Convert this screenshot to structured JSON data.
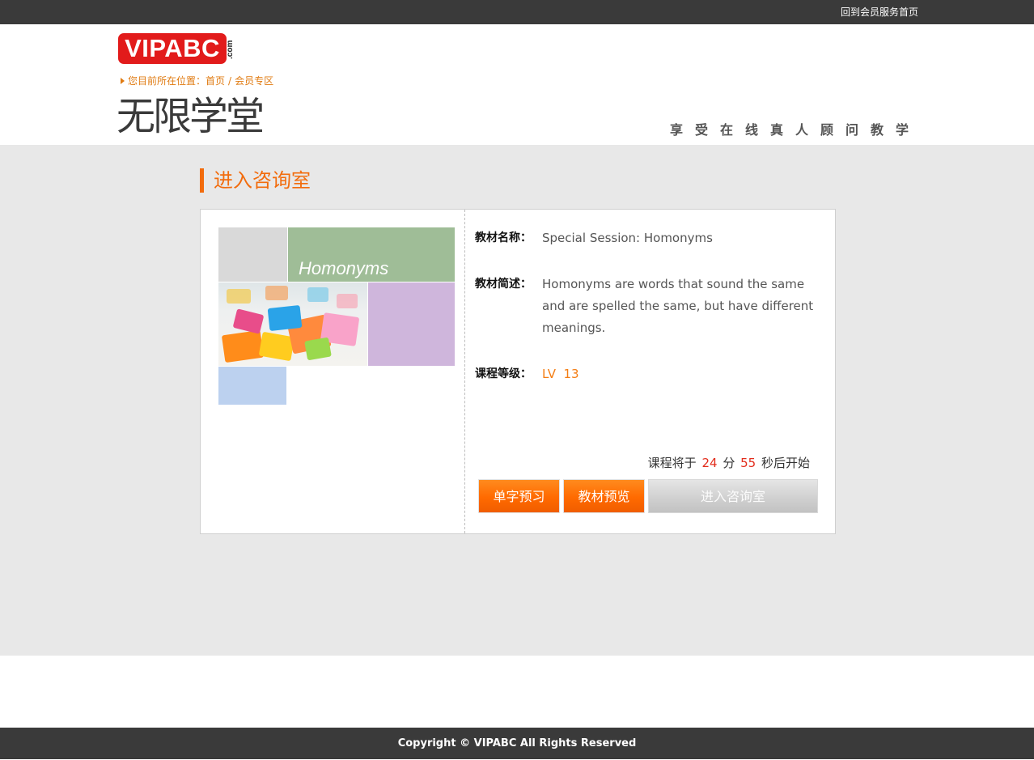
{
  "topbar": {
    "link": "回到会员服务首页"
  },
  "header": {
    "logo_text": "VIPABC",
    "logo_suffix": ".com",
    "breadcrumb_prefix": "您目前所在位置：",
    "breadcrumb": [
      "首页",
      "会员专区"
    ],
    "breadcrumb_sep": "/",
    "page_title": "无限学堂",
    "slogan": "享受在线真人顾问教学"
  },
  "section": {
    "title": "进入咨询室"
  },
  "material": {
    "thumbnail_title": "Homonyms",
    "name_label": "教材名称：",
    "name": "Special Session: Homonyms",
    "desc_label": "教材简述：",
    "desc": "Homonyms are words that sound the same and are spelled the same, but have different meanings.",
    "level_label": "课程等级：",
    "level": "LV  13"
  },
  "countdown": {
    "prefix": "课程将于",
    "minutes": "24",
    "min_unit": "分",
    "seconds": "55",
    "suffix": "秒后开始"
  },
  "buttons": {
    "vocab_preview": "单字预习",
    "material_preview": "教材预览",
    "enter_room": "进入咨询室"
  },
  "footer": {
    "copyright": "Copyright © VIPABC All Rights Reserved"
  },
  "colors": {
    "accent": "#f26c0d",
    "brand_red": "#e21b1b",
    "dark_bar": "#3a3a3a",
    "countdown_num": "#e22d1c"
  }
}
